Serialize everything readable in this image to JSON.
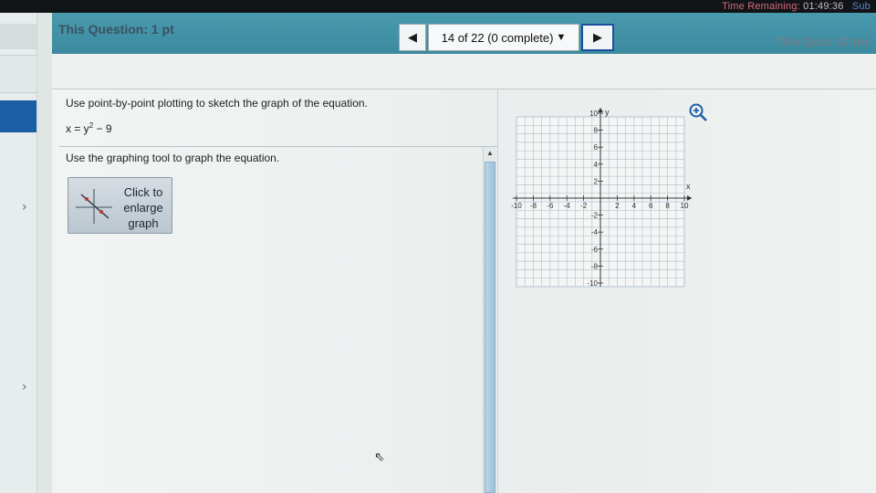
{
  "timer": {
    "label": "Time Remaining:",
    "value": "01:49:36",
    "submit": "Sub"
  },
  "header": {
    "question_label": "This Question: 1 pt",
    "quiz_label": "This Quiz: 22 pts",
    "progress_text": "14 of 22 (0 complete)"
  },
  "question": {
    "instruction": "Use point-by-point plotting to sketch the graph of the equation.",
    "equation": "x = y² − 9",
    "tool_instruction": "Use the graphing tool to graph the equation.",
    "enlarge_button": [
      "Click to",
      "enlarge",
      "graph"
    ]
  },
  "graph": {
    "x_label": "x",
    "y_label": "y",
    "x_ticks": [
      "-10",
      "-8",
      "-6",
      "-4",
      "-2",
      "2",
      "4",
      "6",
      "8",
      "10"
    ],
    "y_ticks": [
      "10",
      "8",
      "6",
      "4",
      "2",
      "-2",
      "-4",
      "-6",
      "-8",
      "-10"
    ],
    "range": [
      -10,
      10
    ]
  },
  "icons": {
    "nav_prev": "triangle-left",
    "nav_next": "triangle-right",
    "zoom": "zoom-in-icon",
    "sidebar_arrows": "chevron-right-icon"
  },
  "colors": {
    "header": "#4a9aae",
    "sidebar_active": "#1a5fa3",
    "timer_red": "#d86a7c",
    "next_border": "#1d4fa0"
  }
}
